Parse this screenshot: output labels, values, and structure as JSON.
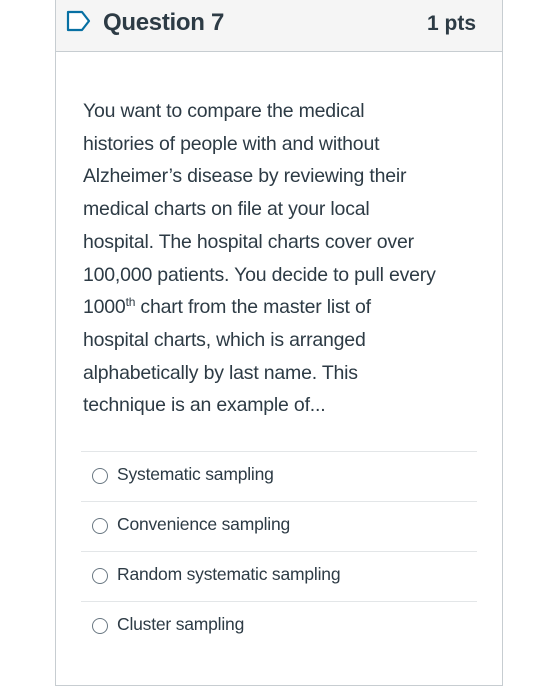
{
  "question": {
    "title": "Question 7",
    "points": "1 pts",
    "text_lines": [
      "You want to compare the medical",
      "histories of people with and without",
      "Alzheimer’s disease by reviewing their",
      "medical charts on file at your local",
      "hospital. The hospital charts cover over",
      "100,000 patients. You decide to pull every"
    ],
    "line7_prefix": "1000",
    "line7_sup": "th",
    "line7_suffix": " chart from the master list of",
    "text_lines_end": [
      "hospital charts, which is  arranged",
      "alphabetically by last name. This",
      "technique is an example of..."
    ]
  },
  "answers": [
    {
      "label": "Systematic sampling"
    },
    {
      "label": "Convenience sampling"
    },
    {
      "label": "Random systematic sampling"
    },
    {
      "label": "Cluster sampling"
    }
  ],
  "icons": {
    "flag": "bookmark-flag-icon",
    "radio": "radio-unselected-icon"
  },
  "colors": {
    "text": "#2d3b45",
    "header_bg": "#f5f5f5",
    "border": "#c7cdd1",
    "flag_accent": "#0770a3"
  }
}
